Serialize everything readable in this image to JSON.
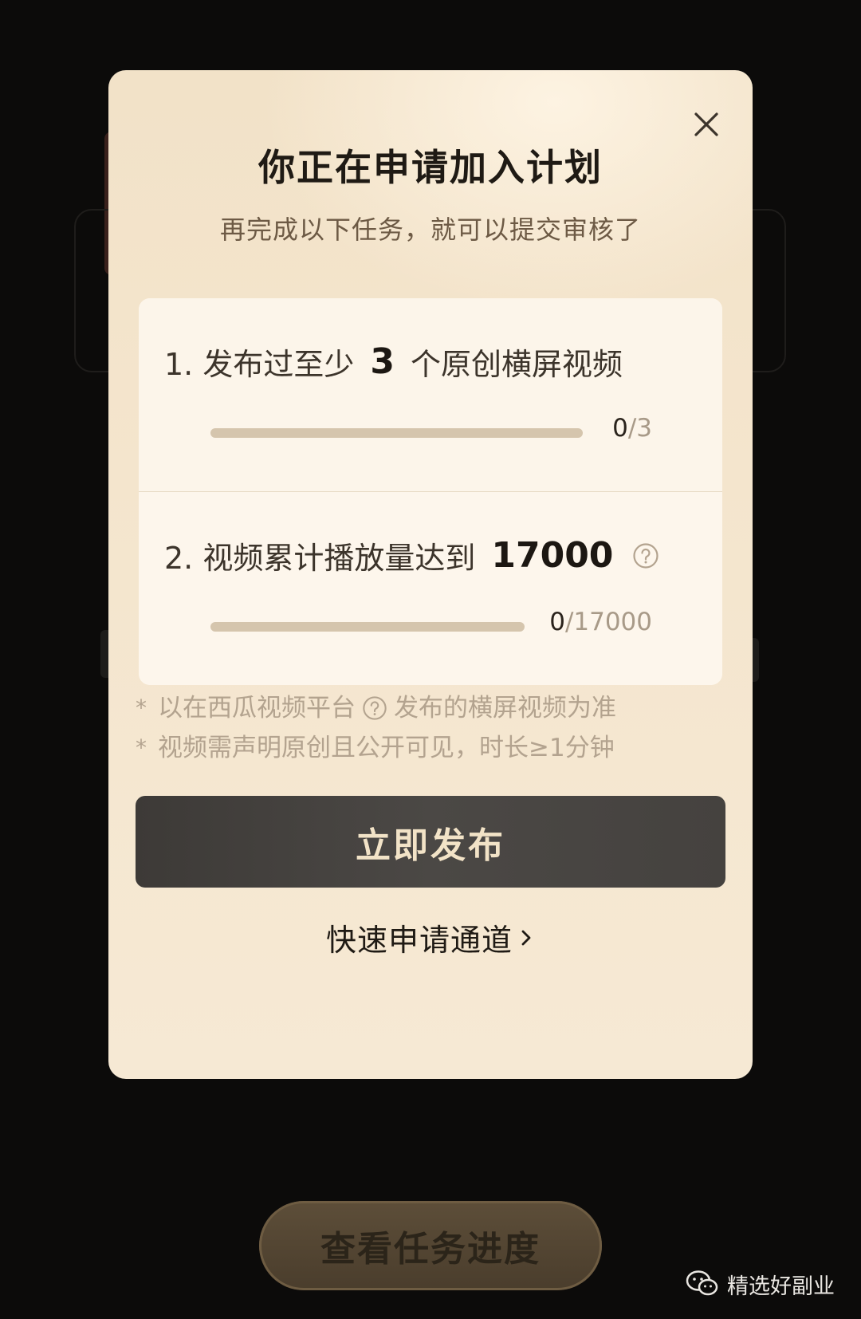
{
  "modal": {
    "title": "你正在申请加入计划",
    "subtitle": "再完成以下任务，就可以提交审核了",
    "close_icon": "close-icon",
    "tasks": [
      {
        "prefix": "1. 发布过至少",
        "number": "3",
        "suffix": "个原创横屏视频",
        "progress_current": "0",
        "progress_total": "/3",
        "progress_fraction": 0
      },
      {
        "prefix": "2. 视频累计播放量达到",
        "number": "17000",
        "suffix": "",
        "progress_current": "0",
        "progress_total": "/17000",
        "progress_fraction": 0,
        "help_icon": "question-circle-icon"
      }
    ],
    "notes": [
      {
        "star": "*",
        "before": "以在西瓜视频平台",
        "after": "发布的横屏视频为准",
        "help_icon": "question-circle-icon"
      },
      {
        "star": "*",
        "text": "视频需声明原创且公开可见，时长≥1分钟"
      }
    ],
    "publish_button": "立即发布",
    "quick_link": "快速申请通道",
    "quick_link_icon": "chevron-right-icon"
  },
  "background": {
    "progress_button": "查看任务进度"
  },
  "watermark": {
    "text": "精选好副业",
    "icon": "wechat-icon"
  },
  "colors": {
    "modal_bg": "#f4e5cd",
    "button_dark": "#45423f",
    "button_text": "#f2e3c7",
    "track": "#d5c5ad",
    "note_text": "#b3a38f"
  }
}
